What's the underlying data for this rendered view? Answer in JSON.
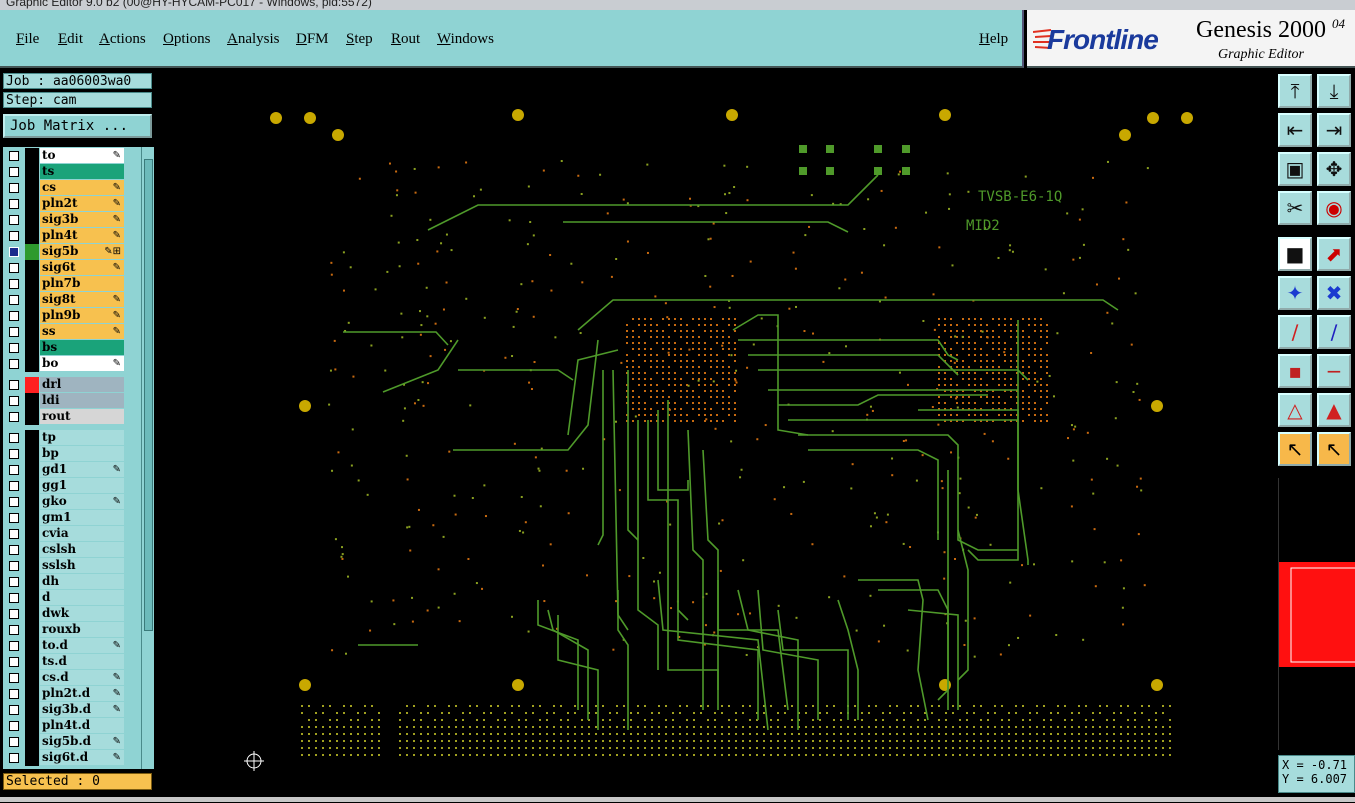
{
  "window": {
    "title": "Graphic Editor 9.0 b2 (00@HY-HYCAM-PC017 - Windows, pid:5572)"
  },
  "menu": {
    "items": [
      "File",
      "Edit",
      "Actions",
      "Options",
      "Analysis",
      "DFM",
      "Step",
      "Rout",
      "Windows"
    ],
    "help": "Help"
  },
  "brand": {
    "logo": "Frontline",
    "product": "Genesis 2000",
    "version_fragment": "04",
    "subtitle": "Graphic Editor"
  },
  "job": {
    "label": "Job : aa06003wa0",
    "step": "Step: cam",
    "matrix_button": "Job Matrix ..."
  },
  "layers": [
    {
      "name": "to",
      "bg": "#ffffff",
      "mark": "pencil",
      "swatch": ""
    },
    {
      "name": "ts",
      "bg": "#1aa37a",
      "mark": "",
      "swatch": ""
    },
    {
      "name": "cs",
      "bg": "#f7c14f",
      "mark": "pencil",
      "swatch": ""
    },
    {
      "name": "pln2t",
      "bg": "#f7c14f",
      "mark": "pencil",
      "swatch": ""
    },
    {
      "name": "sig3b",
      "bg": "#f7c14f",
      "mark": "pencil",
      "swatch": ""
    },
    {
      "name": "pln4t",
      "bg": "#f7c14f",
      "mark": "pencil",
      "swatch": ""
    },
    {
      "name": "sig5b",
      "bg": "#f7c14f",
      "mark": "pencil-plus",
      "swatch": "#2e9a2e",
      "checked": true
    },
    {
      "name": "sig6t",
      "bg": "#f7c14f",
      "mark": "pencil",
      "swatch": ""
    },
    {
      "name": "pln7b",
      "bg": "#f7c14f",
      "mark": "",
      "swatch": ""
    },
    {
      "name": "sig8t",
      "bg": "#f7c14f",
      "mark": "pencil",
      "swatch": ""
    },
    {
      "name": "pln9b",
      "bg": "#f7c14f",
      "mark": "pencil",
      "swatch": ""
    },
    {
      "name": "ss",
      "bg": "#f7c14f",
      "mark": "pencil",
      "swatch": ""
    },
    {
      "name": "bs",
      "bg": "#1aa37a",
      "mark": "",
      "swatch": ""
    },
    {
      "name": "bo",
      "bg": "#ffffff",
      "mark": "pencil",
      "swatch": ""
    },
    {
      "name": "drl",
      "bg": "#9fb4c0",
      "mark": "",
      "swatch": "#ff2020",
      "gap": true
    },
    {
      "name": "ldi",
      "bg": "#9fb4c0",
      "mark": "",
      "swatch": ""
    },
    {
      "name": "rout",
      "bg": "#d6d6d6",
      "mark": "",
      "swatch": ""
    },
    {
      "name": "tp",
      "bg": "#a6dcdc",
      "mark": "",
      "swatch": "",
      "gap": true
    },
    {
      "name": "bp",
      "bg": "#a6dcdc",
      "mark": "",
      "swatch": ""
    },
    {
      "name": "gd1",
      "bg": "#a6dcdc",
      "mark": "pencil",
      "swatch": ""
    },
    {
      "name": "gg1",
      "bg": "#a6dcdc",
      "mark": "",
      "swatch": ""
    },
    {
      "name": "gko",
      "bg": "#a6dcdc",
      "mark": "pencil",
      "swatch": ""
    },
    {
      "name": "gm1",
      "bg": "#a6dcdc",
      "mark": "",
      "swatch": ""
    },
    {
      "name": "cvia",
      "bg": "#a6dcdc",
      "mark": "",
      "swatch": ""
    },
    {
      "name": "cslsh",
      "bg": "#a6dcdc",
      "mark": "",
      "swatch": ""
    },
    {
      "name": "sslsh",
      "bg": "#a6dcdc",
      "mark": "",
      "swatch": ""
    },
    {
      "name": "dh",
      "bg": "#a6dcdc",
      "mark": "",
      "swatch": ""
    },
    {
      "name": "d",
      "bg": "#a6dcdc",
      "mark": "",
      "swatch": ""
    },
    {
      "name": "dwk",
      "bg": "#a6dcdc",
      "mark": "",
      "swatch": ""
    },
    {
      "name": "rouxb",
      "bg": "#a6dcdc",
      "mark": "",
      "swatch": ""
    },
    {
      "name": "to.d",
      "bg": "#a6dcdc",
      "mark": "pencil",
      "swatch": ""
    },
    {
      "name": "ts.d",
      "bg": "#a6dcdc",
      "mark": "",
      "swatch": ""
    },
    {
      "name": "cs.d",
      "bg": "#a6dcdc",
      "mark": "pencil",
      "swatch": ""
    },
    {
      "name": "pln2t.d",
      "bg": "#a6dcdc",
      "mark": "pencil",
      "swatch": ""
    },
    {
      "name": "sig3b.d",
      "bg": "#a6dcdc",
      "mark": "pencil",
      "swatch": ""
    },
    {
      "name": "pln4t.d",
      "bg": "#a6dcdc",
      "mark": "",
      "swatch": ""
    },
    {
      "name": "sig5b.d",
      "bg": "#a6dcdc",
      "mark": "pencil",
      "swatch": ""
    },
    {
      "name": "sig6t.d",
      "bg": "#a6dcdc",
      "mark": "pencil",
      "swatch": ""
    }
  ],
  "selected": "Selected : 0",
  "canvas": {
    "labels": [
      "TVSB-E6-1Q",
      "MID2"
    ],
    "trace_color": "#4f9a2a",
    "pad_color": "#c8a800"
  },
  "coords": {
    "x": "X = -0.71",
    "y": "Y = 6.007"
  },
  "toolbar_icons": [
    "zoom-home-icon",
    "zoom-page-icon",
    "pan-left-icon",
    "pan-right-icon",
    "fit-icon",
    "zoom-area-icon",
    "measure-icon",
    "snap-icon",
    "select-mode-icon",
    "feature-icon",
    "connect-icon",
    "delete-icon",
    "line-icon",
    "arc-icon",
    "pad-icon",
    "edit-line-icon",
    "polygon-icon",
    "cross-icon",
    "pointer-icon",
    "pointer-select-icon"
  ]
}
